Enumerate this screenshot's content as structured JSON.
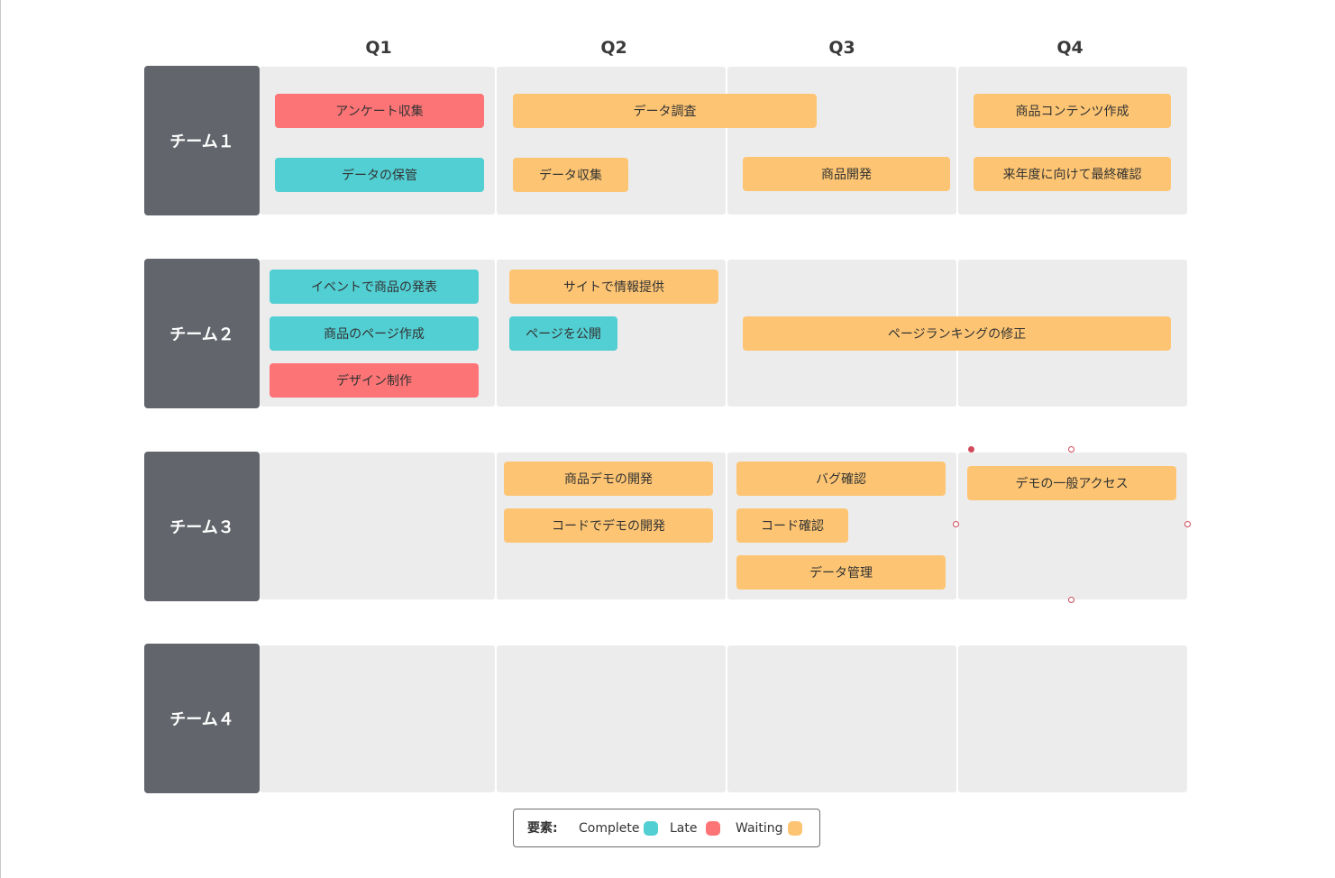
{
  "quarters": [
    "Q1",
    "Q2",
    "Q3",
    "Q4"
  ],
  "teams": [
    "チーム１",
    "チーム２",
    "チーム３",
    "チーム４"
  ],
  "tasks": {
    "t1_survey": "アンケート収集",
    "t1_storage": "データの保管",
    "t1_research": "データ調査",
    "t1_collect": "データ収集",
    "t1_product_dev": "商品開発",
    "t1_content": "商品コンテンツ作成",
    "t1_final": "来年度に向けて最終確認",
    "t2_event": "イベントで商品の発表",
    "t2_page_create": "商品のページ作成",
    "t2_design": "デザイン制作",
    "t2_site_info": "サイトで情報提供",
    "t2_publish": "ページを公開",
    "t2_ranking": "ページランキングの修正",
    "t3_demo_dev": "商品デモの開発",
    "t3_code_demo": "コードでデモの開発",
    "t3_bug": "バグ確認",
    "t3_code_check": "コード確認",
    "t3_data_mgmt": "データ管理",
    "t3_demo_access": "デモの一般アクセス"
  },
  "legend": {
    "title": "要素:",
    "complete": "Complete",
    "late": "Late",
    "waiting": "Waiting"
  },
  "colors": {
    "complete": "#52cfd3",
    "late": "#fd7476",
    "waiting": "#fdc573",
    "team_header": "#62666c",
    "cell_bg": "#ececec"
  }
}
